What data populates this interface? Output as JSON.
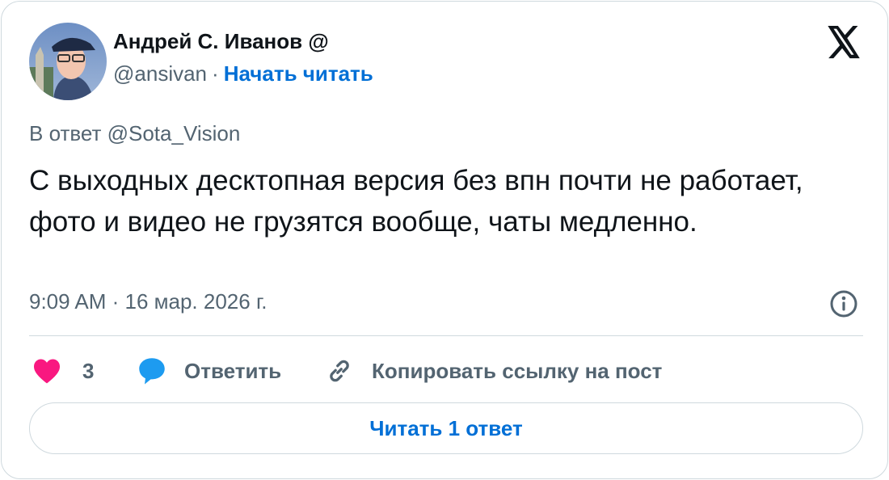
{
  "author": {
    "name": "Андрей С. Иванов @",
    "handle": "@ansivan",
    "separator": "·",
    "follow_label": "Начать читать"
  },
  "tweet": {
    "reply_to": "В ответ @Sota_Vision",
    "text": "С выходных десктопная версия без впн почти не работает, фото и видео не грузятся вообще, чаты медленно.",
    "timestamp": "9:09 AM · 16 мар. 2026 г."
  },
  "actions": {
    "like_count": "3",
    "reply_label": "Ответить",
    "copy_label": "Копировать ссылку на пост"
  },
  "read_replies_label": "Читать 1 ответ",
  "icons": {
    "logo": "x-logo-icon",
    "info": "info-icon",
    "like": "heart-icon",
    "reply": "speech-bubble-icon",
    "copy": "link-icon"
  },
  "colors": {
    "link": "#006fd6",
    "heart": "#f91880",
    "reply_bubble": "#1d9bf0",
    "muted_text": "#536471",
    "border": "#cfd9de"
  }
}
